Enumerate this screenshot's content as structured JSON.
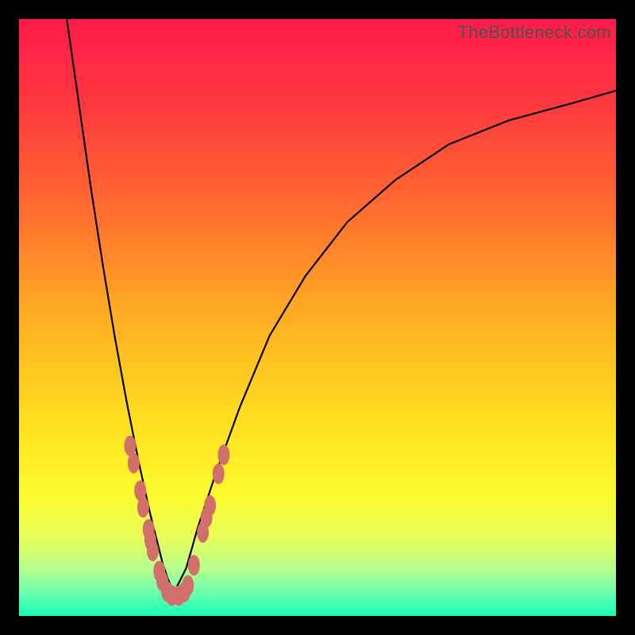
{
  "watermark_text": "TheBottleneck.com",
  "chart_data": {
    "type": "line",
    "title": "",
    "xlabel": "",
    "ylabel": "",
    "xlim": [
      0,
      100
    ],
    "ylim": [
      0,
      100
    ],
    "series": [
      {
        "name": "curve-left",
        "x": [
          8,
          10,
          12,
          14,
          16,
          18,
          20,
          22,
          23,
          24,
          25,
          26
        ],
        "y": [
          100,
          86,
          72,
          59,
          47,
          36,
          26,
          17,
          13,
          9,
          6,
          4
        ]
      },
      {
        "name": "curve-right",
        "x": [
          26,
          28,
          30,
          33,
          37,
          42,
          48,
          55,
          63,
          72,
          82,
          93,
          100
        ],
        "y": [
          4,
          8,
          15,
          24,
          35,
          47,
          57,
          66,
          73,
          79,
          83,
          86,
          88
        ]
      }
    ],
    "markers": {
      "name": "oval-dots",
      "color": "#d36f6a",
      "points": [
        {
          "x": 18.6,
          "y": 28.5
        },
        {
          "x": 19.2,
          "y": 25.6
        },
        {
          "x": 20.3,
          "y": 21.0
        },
        {
          "x": 20.8,
          "y": 18.2
        },
        {
          "x": 21.7,
          "y": 14.5
        },
        {
          "x": 22.0,
          "y": 12.7
        },
        {
          "x": 22.4,
          "y": 10.9
        },
        {
          "x": 23.5,
          "y": 7.5
        },
        {
          "x": 24.0,
          "y": 5.8
        },
        {
          "x": 24.8,
          "y": 4.1
        },
        {
          "x": 25.6,
          "y": 3.4
        },
        {
          "x": 26.8,
          "y": 3.4
        },
        {
          "x": 27.7,
          "y": 4.0
        },
        {
          "x": 28.3,
          "y": 5.1
        },
        {
          "x": 29.3,
          "y": 8.5
        },
        {
          "x": 30.8,
          "y": 14.0
        },
        {
          "x": 31.4,
          "y": 16.5
        },
        {
          "x": 32.0,
          "y": 18.5
        },
        {
          "x": 33.4,
          "y": 23.8
        },
        {
          "x": 34.3,
          "y": 27.0
        }
      ]
    },
    "gradient_stops": [
      {
        "offset": 0.0,
        "color": "#ff1a4a"
      },
      {
        "offset": 0.15,
        "color": "#ff3a3e"
      },
      {
        "offset": 0.32,
        "color": "#ff6d2f"
      },
      {
        "offset": 0.5,
        "color": "#ffae23"
      },
      {
        "offset": 0.68,
        "color": "#ffe11e"
      },
      {
        "offset": 0.8,
        "color": "#fcfb2f"
      },
      {
        "offset": 0.87,
        "color": "#e7fd5a"
      },
      {
        "offset": 0.92,
        "color": "#b6ff8c"
      },
      {
        "offset": 0.96,
        "color": "#6effb0"
      },
      {
        "offset": 1.0,
        "color": "#13ffb6"
      },
      {
        "offset": 1.0,
        "color": "#00e69b"
      }
    ]
  }
}
